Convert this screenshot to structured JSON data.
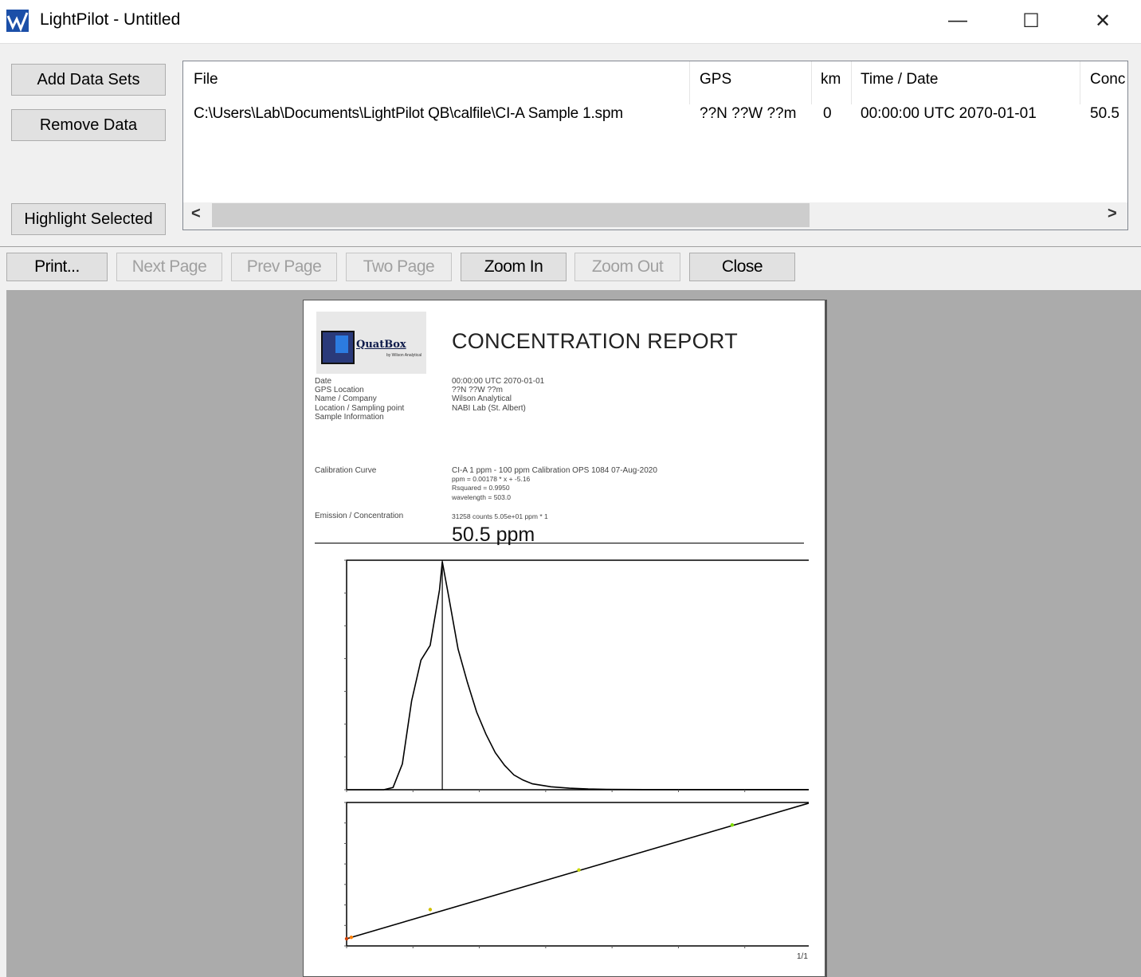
{
  "window": {
    "title": "LightPilot - Untitled",
    "minimize": "—",
    "maximize": "☐",
    "close": "✕"
  },
  "panel": {
    "add_label": "Add Data Sets",
    "remove_label": "Remove Data",
    "highlight_label": "Highlight Selected"
  },
  "table": {
    "headers": [
      "File",
      "GPS",
      "km",
      "Time / Date",
      "Conc"
    ],
    "rows": [
      [
        "C:\\Users\\Lab\\Documents\\LightPilot QB\\calfile\\CI-A Sample 1.spm",
        "??N ??W ??m",
        "0",
        "00:00:00 UTC  2070-01-01",
        "50.5"
      ]
    ]
  },
  "toolbar": {
    "print": "Print...",
    "next": "Next Page",
    "prev": "Prev Page",
    "two": "Two Page",
    "zoom_in": "Zoom In",
    "zoom_out": "Zoom Out",
    "close": "Close"
  },
  "report": {
    "logo_text": "QuatBox",
    "logo_sub": "by Wilson Analytical",
    "title": "CONCENTRATION REPORT",
    "labels": [
      "Date",
      "GPS Location",
      "Name / Company",
      "Location / Sampling point",
      "Sample Information"
    ],
    "values": [
      "00:00:00 UTC  2070-01-01",
      "??N ??W ??m",
      "Wilson Analytical",
      "NABI Lab (St. Albert)",
      ""
    ],
    "calib_label": "Calibration Curve",
    "calib_lines": [
      "CI-A 1 ppm - 100 ppm Calibration OPS 1084 07-Aug-2020",
      "ppm = 0.00178 * x + -5.16",
      "Rsquared = 0.9950",
      "wavelength = 503.0"
    ],
    "emission_label": "Emission / Concentration",
    "emission_value": "31258 counts  5.05e+01 ppm * 1",
    "result": "50.5 ppm",
    "page_number": "1/1"
  },
  "chart_data": [
    {
      "type": "line",
      "title": "",
      "xlabel": "",
      "ylabel": "",
      "x": [
        400,
        420,
        440,
        450,
        460,
        470,
        480,
        490,
        500,
        503,
        510,
        520,
        530,
        540,
        550,
        560,
        570,
        580,
        590,
        600,
        620,
        640,
        660,
        680,
        700,
        720,
        740,
        760,
        780,
        800,
        820,
        840,
        860,
        880,
        900
      ],
      "y": [
        0,
        0,
        0,
        300,
        3500,
        12000,
        17500,
        19500,
        27000,
        30800,
        26000,
        19000,
        14500,
        10500,
        7500,
        5000,
        3300,
        2000,
        1300,
        800,
        400,
        200,
        100,
        50,
        30,
        20,
        20,
        20,
        20,
        20,
        20,
        20,
        20,
        20,
        20
      ],
      "marker_x": 503,
      "xlim": [
        400,
        900
      ],
      "ylim": [
        0,
        31000
      ]
    },
    {
      "type": "scatter",
      "title": "",
      "xlabel": "",
      "ylabel": "",
      "points": [
        [
          0,
          2900
        ],
        [
          1,
          3464
        ],
        [
          18,
          14700
        ],
        [
          50,
          30700
        ],
        [
          83,
          48900
        ],
        [
          100,
          58000
        ]
      ],
      "fit": [
        [
          0,
          2900
        ],
        [
          100,
          58000
        ]
      ],
      "point_colors": [
        "#d04000",
        "#ff7f00",
        "#d0c000",
        "#c8d800",
        "#80e000",
        "#00cc00"
      ],
      "xlim": [
        0,
        100
      ],
      "ylim": [
        0,
        58000
      ]
    }
  ],
  "colors": {
    "preview_bg": "#ababab",
    "page_bg": "#ffffff"
  }
}
